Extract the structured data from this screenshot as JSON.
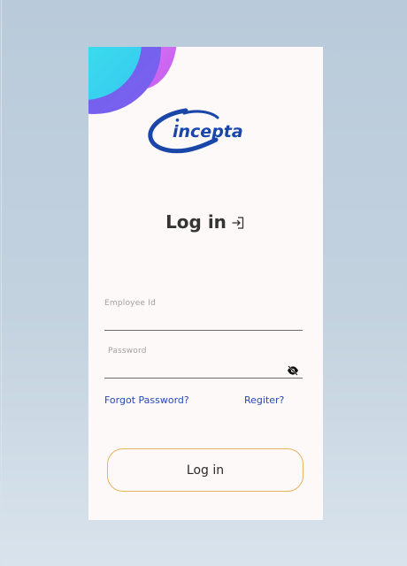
{
  "brand": {
    "logo_icon": "incepta-logo",
    "logo_text": "incepta",
    "color": "#1946a8"
  },
  "header": {
    "title": "Log in",
    "title_icon": "login-icon"
  },
  "form": {
    "employee_id": {
      "label": "Employee Id",
      "value": ""
    },
    "password": {
      "label": "Password",
      "value": "",
      "toggle_icon": "eye-off-icon"
    }
  },
  "links": {
    "forgot_password": "Forgot Password?",
    "register": "Regiter?"
  },
  "actions": {
    "login_button": "Log in"
  },
  "colors": {
    "link": "#2847b8",
    "button_border": "#e9b45e",
    "card_background": "#fdf9f8"
  }
}
